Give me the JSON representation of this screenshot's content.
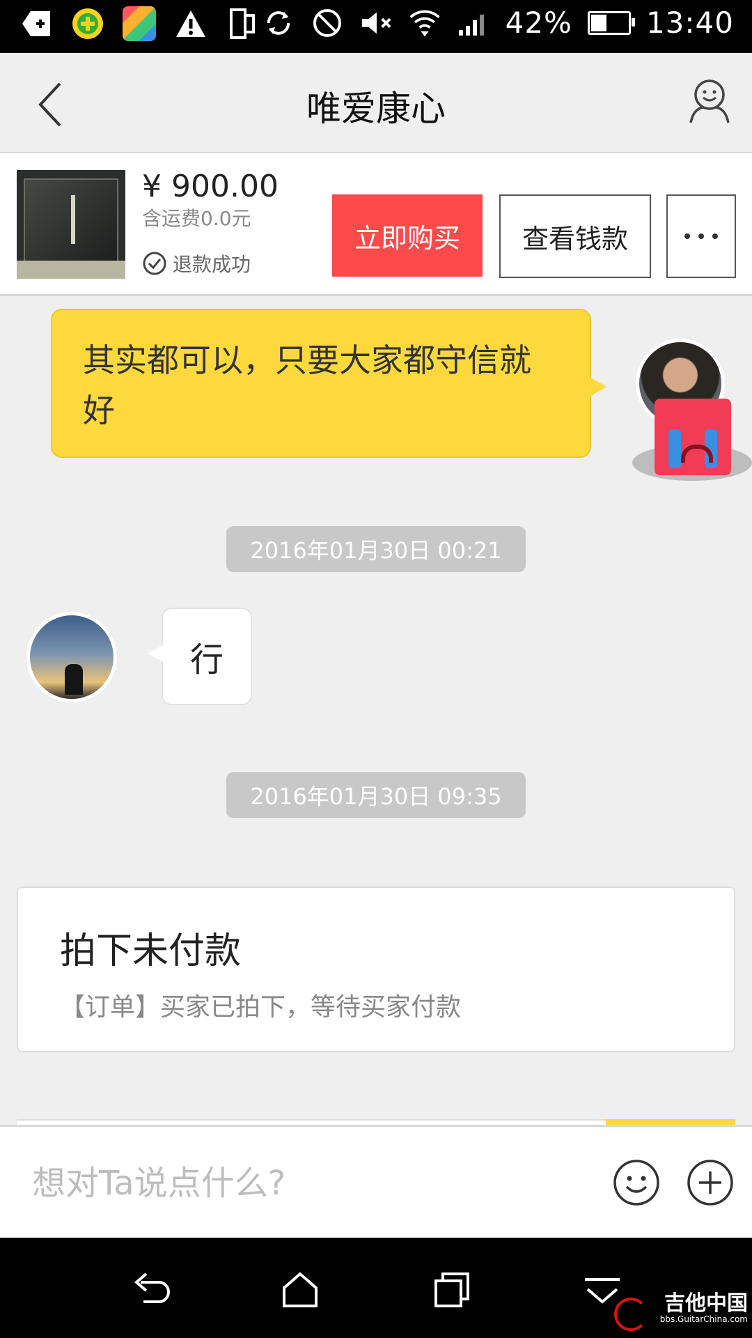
{
  "status_bar": {
    "battery_percent": "42%",
    "battery_level": 0.42,
    "time": "13:40",
    "left_icons": [
      "back-cross-icon",
      "360-security-app-icon",
      "colorful-app-icon",
      "warning-icon",
      "dual-screen-icon"
    ],
    "right_icons": [
      "sync-icon",
      "blocked-icon",
      "mute-icon",
      "wifi-icon",
      "signal-icon",
      "battery-icon"
    ]
  },
  "header": {
    "title": "唯爱康心",
    "back_icon": "chevron-left-icon",
    "profile_icon": "person-icon"
  },
  "product": {
    "price": "¥ 900.00",
    "shipping": "含运费0.0元",
    "status": "退款成功",
    "buy_label": "立即购买",
    "view_label": "查看钱款",
    "more_icon": "more-dots-icon"
  },
  "messages": {
    "incoming_right_text": "其实都可以，只要大家都守信就好",
    "timestamp_1": "2016年01月30日 00:21",
    "outgoing_left_text": "行",
    "timestamp_2": "2016年01月30日 09:35"
  },
  "order_card": {
    "title": "拍下未付款",
    "description": "【订单】买家已拍下，等待买家付款"
  },
  "input": {
    "placeholder": "想对Ta说点什么?"
  },
  "system_nav": {
    "icons": [
      "back-arrow-icon",
      "home-icon",
      "recents-icon",
      "collapse-icon"
    ]
  },
  "watermark": {
    "name": "吉他中国",
    "url": "bbs.GuitarChina.com"
  },
  "colors": {
    "accent_red": "#fe4a4a",
    "bubble_yellow": "#fdd93d"
  }
}
